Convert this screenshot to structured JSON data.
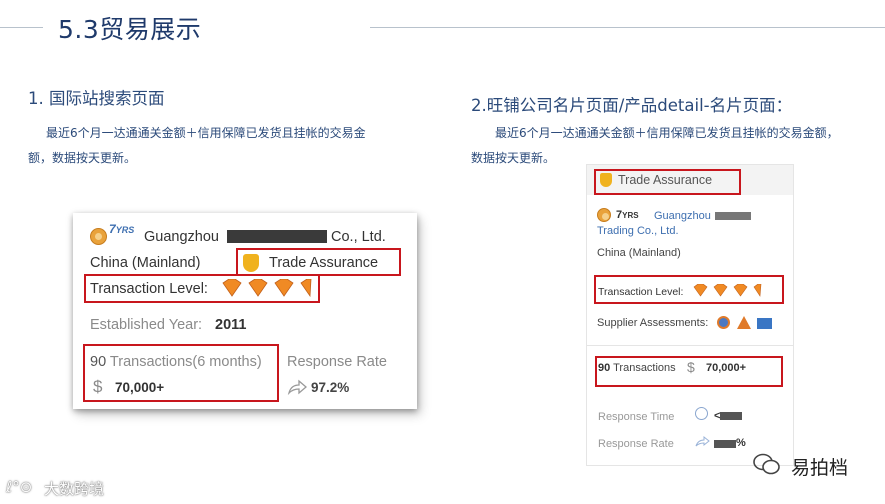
{
  "header": {
    "title": "5.3贸易展示"
  },
  "left_section": {
    "title": "1.  国际站搜索页面",
    "desc_line1": "最近6个月一达通通关金额＋信用保障已发货且挂帐的交易金",
    "desc_line2": "额，数据按天更新。",
    "card": {
      "years": "7",
      "years_unit": "YRS",
      "company_start": "Guangzhou",
      "company_end": "Co., Ltd.",
      "location": "China (Mainland)",
      "trade_assurance": "Trade Assurance",
      "transaction_level_label": "Transaction Level:",
      "established_label": "Established Year:",
      "established_value": "2011",
      "transactions_count": "90",
      "transactions_label": "Transactions(6 months)",
      "transactions_amount": "70,000+",
      "response_rate_label": "Response Rate",
      "response_rate_value": "97.2%"
    }
  },
  "right_section": {
    "title": "2.旺铺公司名片页面/产品detail-名片页面：",
    "desc_line1": "最近6个月一达通通关金额＋信用保障已发货且挂帐的交易金额，",
    "desc_line2": "数据按天更新。",
    "card": {
      "trade_assurance": "Trade Assurance",
      "years": "7",
      "years_unit": "YRS",
      "company_line1": "Guangzhou",
      "company_line2": "Trading Co., Ltd.",
      "location": "China (Mainland)",
      "transaction_level_label": "Transaction Level:",
      "supplier_assessments_label": "Supplier Assessments:",
      "transactions_count": "90",
      "transactions_label": "Transactions",
      "transactions_amount": "70,000+",
      "response_time_label": "Response Time",
      "response_time_value": "<",
      "response_rate_label": "Response Rate",
      "response_rate_value": "%"
    }
  },
  "watermarks": {
    "bottom_left": "大数跨境",
    "bottom_right": "易拍档"
  },
  "colors": {
    "heading": "#1f3a6b",
    "highlight_box": "#c8161d",
    "gem": "#f08a24",
    "link": "#3e6fb0"
  }
}
